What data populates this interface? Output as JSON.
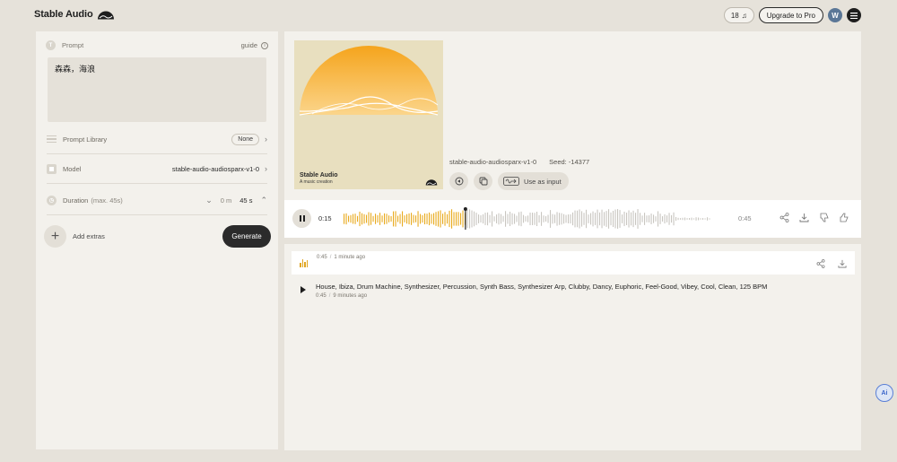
{
  "header": {
    "logo_text": "Stable Audio",
    "credits": "18",
    "credits_icon": "music-note-icon",
    "upgrade_label": "Upgrade to Pro",
    "avatar_initial": "W"
  },
  "left_panel": {
    "prompt_label": "Prompt",
    "guide_label": "guide",
    "prompt_value": "森森，海浪",
    "prompt_library_label": "Prompt Library",
    "prompt_library_value": "None",
    "model_label": "Model",
    "model_value": "stable-audio-audiosparx-v1-0",
    "duration_label": "Duration",
    "duration_hint": "(max. 45s)",
    "duration_min": "0 m",
    "duration_sec": "45 s",
    "add_extras_label": "Add extras",
    "generate_label": "Generate"
  },
  "track": {
    "cover_title": "Stable Audio",
    "cover_subtitle": "A music creation",
    "model": "stable-audio-audiosparx-v1-0",
    "seed": "Seed: -14377",
    "use_as_input_label": "Use as input"
  },
  "player": {
    "current_time": "0:15",
    "total_time": "0:45",
    "progress": 0.33,
    "colors": {
      "played": "#e8ab1f",
      "unplayed": "#c9c6c0"
    }
  },
  "history": {
    "card": {
      "duration": "0:45",
      "ago": "1 minute ago"
    },
    "items": [
      {
        "text": "House, Ibiza, Drum Machine, Synthesizer, Percussion, Synth Bass, Synthesizer Arp, Clubby, Dancy, Euphoric, Feel-Good, Vibey, Cool, Clean, 125 BPM",
        "duration": "0:45",
        "ago": "9 minutes ago"
      }
    ]
  },
  "ai_badge": "Ai"
}
